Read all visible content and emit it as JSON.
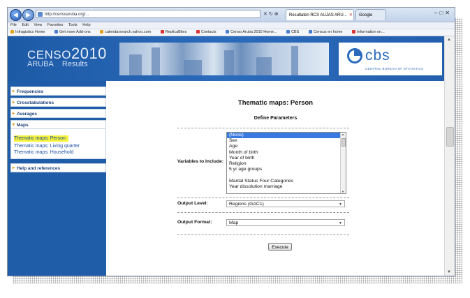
{
  "browser": {
    "address": "http://censoaruba.org/...",
    "tabs": [
      {
        "label": "Resultaten RCS AUJAS ARU...",
        "active": true
      },
      {
        "label": "Google",
        "active": false
      }
    ],
    "menu": [
      "File",
      "Edit",
      "View",
      "Favorites",
      "Tools",
      "Help"
    ],
    "favorites": [
      "Infragistics Home",
      "Get more Add-ons",
      "calendarsearch.yahoo.com",
      "ReplicaBites",
      "Contacts",
      "Censo Aruba 2010 Home...",
      "CBS",
      "Census en home",
      "Information on..."
    ]
  },
  "banner": {
    "censo_word": "CENSO",
    "censo_year": "2010",
    "aruba": "ARUBA",
    "results": "Results",
    "cbs_logo": "cbs",
    "cbs_tagline": "CENTRAL BUREAU OF STATISTICS"
  },
  "sidebar": {
    "sections": [
      "Frequencies",
      "Crosstabulations",
      "Averages"
    ],
    "maps": {
      "label": "Maps",
      "items": [
        "Thematic maps: Person",
        "Thematic maps: Living quarter",
        "Thematic maps: Household"
      ]
    },
    "help": "Help and references"
  },
  "content": {
    "title": "Thematic maps: Person",
    "subtitle": "Define Parameters",
    "variables_label": "Variables to Include:",
    "variables": [
      "(None)",
      "Sex",
      "Age",
      "Month of birth",
      "Year of birth",
      "Religion",
      "5 yr age groups",
      "",
      "Marital Status Four Categories",
      "Year dissolution marriage"
    ],
    "output_level_label": "Output Level:",
    "output_level_value": "Regions (GAC1)",
    "output_format_label": "Output Format:",
    "output_format_value": "Map",
    "execute_label": "Execute"
  },
  "colors": {
    "brand_blue": "#1f5da9",
    "highlight": "#f7f23a",
    "selection": "#3a7ae0"
  }
}
